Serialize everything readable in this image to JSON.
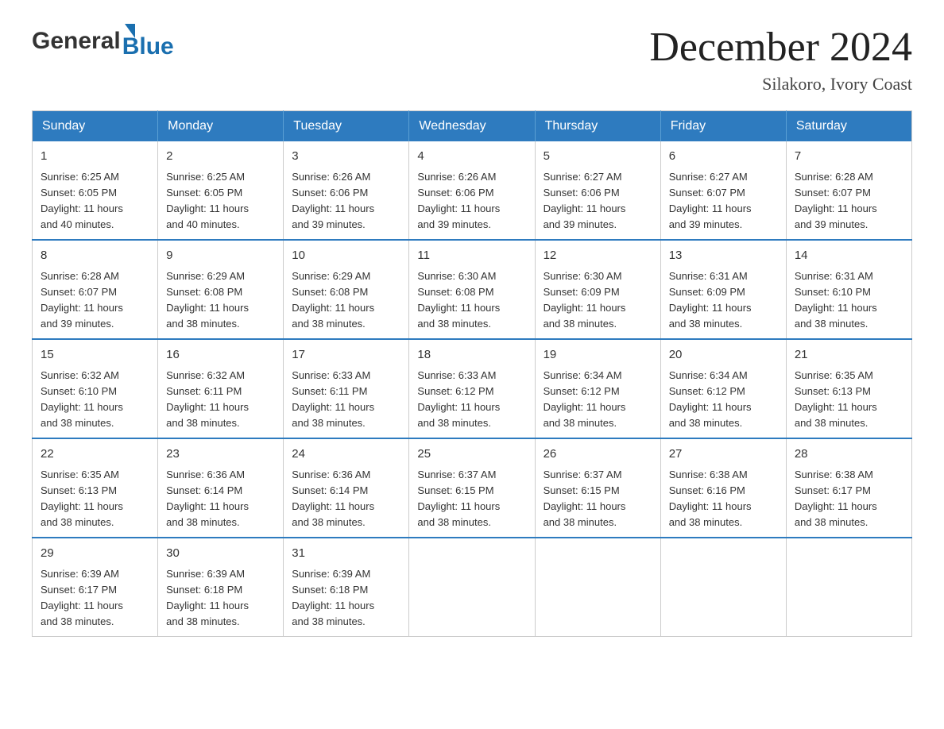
{
  "logo": {
    "text_general": "General",
    "text_blue": "Blue"
  },
  "title": {
    "month_year": "December 2024",
    "location": "Silakoro, Ivory Coast"
  },
  "days_of_week": [
    "Sunday",
    "Monday",
    "Tuesday",
    "Wednesday",
    "Thursday",
    "Friday",
    "Saturday"
  ],
  "weeks": [
    [
      {
        "day": "1",
        "sunrise": "6:25 AM",
        "sunset": "6:05 PM",
        "daylight": "11 hours and 40 minutes."
      },
      {
        "day": "2",
        "sunrise": "6:25 AM",
        "sunset": "6:05 PM",
        "daylight": "11 hours and 40 minutes."
      },
      {
        "day": "3",
        "sunrise": "6:26 AM",
        "sunset": "6:06 PM",
        "daylight": "11 hours and 39 minutes."
      },
      {
        "day": "4",
        "sunrise": "6:26 AM",
        "sunset": "6:06 PM",
        "daylight": "11 hours and 39 minutes."
      },
      {
        "day": "5",
        "sunrise": "6:27 AM",
        "sunset": "6:06 PM",
        "daylight": "11 hours and 39 minutes."
      },
      {
        "day": "6",
        "sunrise": "6:27 AM",
        "sunset": "6:07 PM",
        "daylight": "11 hours and 39 minutes."
      },
      {
        "day": "7",
        "sunrise": "6:28 AM",
        "sunset": "6:07 PM",
        "daylight": "11 hours and 39 minutes."
      }
    ],
    [
      {
        "day": "8",
        "sunrise": "6:28 AM",
        "sunset": "6:07 PM",
        "daylight": "11 hours and 39 minutes."
      },
      {
        "day": "9",
        "sunrise": "6:29 AM",
        "sunset": "6:08 PM",
        "daylight": "11 hours and 38 minutes."
      },
      {
        "day": "10",
        "sunrise": "6:29 AM",
        "sunset": "6:08 PM",
        "daylight": "11 hours and 38 minutes."
      },
      {
        "day": "11",
        "sunrise": "6:30 AM",
        "sunset": "6:08 PM",
        "daylight": "11 hours and 38 minutes."
      },
      {
        "day": "12",
        "sunrise": "6:30 AM",
        "sunset": "6:09 PM",
        "daylight": "11 hours and 38 minutes."
      },
      {
        "day": "13",
        "sunrise": "6:31 AM",
        "sunset": "6:09 PM",
        "daylight": "11 hours and 38 minutes."
      },
      {
        "day": "14",
        "sunrise": "6:31 AM",
        "sunset": "6:10 PM",
        "daylight": "11 hours and 38 minutes."
      }
    ],
    [
      {
        "day": "15",
        "sunrise": "6:32 AM",
        "sunset": "6:10 PM",
        "daylight": "11 hours and 38 minutes."
      },
      {
        "day": "16",
        "sunrise": "6:32 AM",
        "sunset": "6:11 PM",
        "daylight": "11 hours and 38 minutes."
      },
      {
        "day": "17",
        "sunrise": "6:33 AM",
        "sunset": "6:11 PM",
        "daylight": "11 hours and 38 minutes."
      },
      {
        "day": "18",
        "sunrise": "6:33 AM",
        "sunset": "6:12 PM",
        "daylight": "11 hours and 38 minutes."
      },
      {
        "day": "19",
        "sunrise": "6:34 AM",
        "sunset": "6:12 PM",
        "daylight": "11 hours and 38 minutes."
      },
      {
        "day": "20",
        "sunrise": "6:34 AM",
        "sunset": "6:12 PM",
        "daylight": "11 hours and 38 minutes."
      },
      {
        "day": "21",
        "sunrise": "6:35 AM",
        "sunset": "6:13 PM",
        "daylight": "11 hours and 38 minutes."
      }
    ],
    [
      {
        "day": "22",
        "sunrise": "6:35 AM",
        "sunset": "6:13 PM",
        "daylight": "11 hours and 38 minutes."
      },
      {
        "day": "23",
        "sunrise": "6:36 AM",
        "sunset": "6:14 PM",
        "daylight": "11 hours and 38 minutes."
      },
      {
        "day": "24",
        "sunrise": "6:36 AM",
        "sunset": "6:14 PM",
        "daylight": "11 hours and 38 minutes."
      },
      {
        "day": "25",
        "sunrise": "6:37 AM",
        "sunset": "6:15 PM",
        "daylight": "11 hours and 38 minutes."
      },
      {
        "day": "26",
        "sunrise": "6:37 AM",
        "sunset": "6:15 PM",
        "daylight": "11 hours and 38 minutes."
      },
      {
        "day": "27",
        "sunrise": "6:38 AM",
        "sunset": "6:16 PM",
        "daylight": "11 hours and 38 minutes."
      },
      {
        "day": "28",
        "sunrise": "6:38 AM",
        "sunset": "6:17 PM",
        "daylight": "11 hours and 38 minutes."
      }
    ],
    [
      {
        "day": "29",
        "sunrise": "6:39 AM",
        "sunset": "6:17 PM",
        "daylight": "11 hours and 38 minutes."
      },
      {
        "day": "30",
        "sunrise": "6:39 AM",
        "sunset": "6:18 PM",
        "daylight": "11 hours and 38 minutes."
      },
      {
        "day": "31",
        "sunrise": "6:39 AM",
        "sunset": "6:18 PM",
        "daylight": "11 hours and 38 minutes."
      },
      null,
      null,
      null,
      null
    ]
  ],
  "labels": {
    "sunrise": "Sunrise:",
    "sunset": "Sunset:",
    "daylight": "Daylight:"
  }
}
